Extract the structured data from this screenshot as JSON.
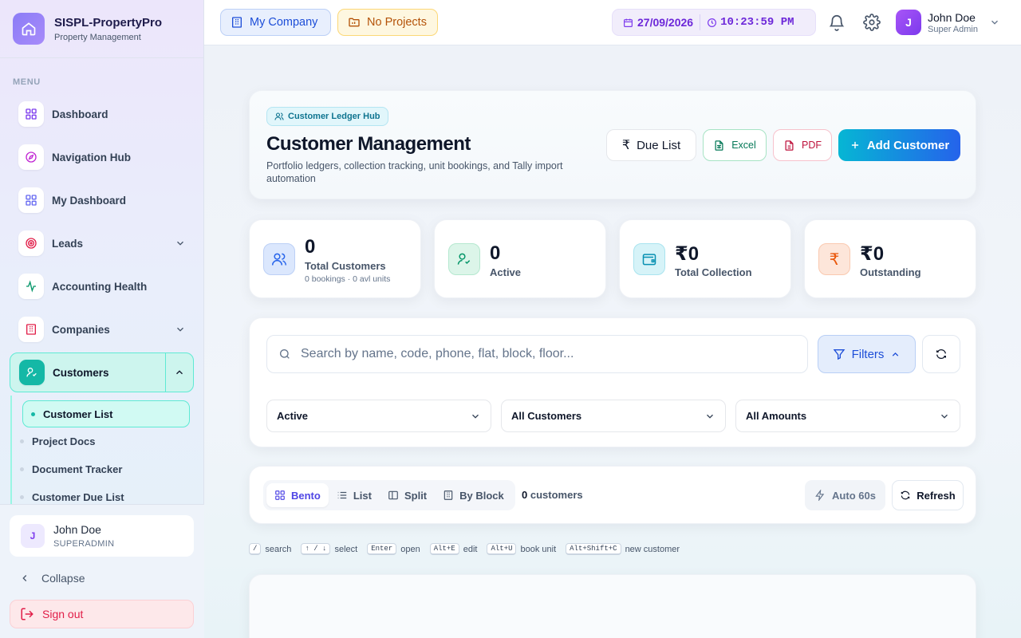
{
  "brand": {
    "name": "SISPL-PropertyPro",
    "subtitle": "Property Management"
  },
  "sidebar": {
    "menu_label": "MENU",
    "items": [
      {
        "label": "Dashboard",
        "icon": "grid-icon"
      },
      {
        "label": "Navigation Hub",
        "icon": "compass-icon"
      },
      {
        "label": "My Dashboard",
        "icon": "grid-icon"
      },
      {
        "label": "Leads",
        "icon": "target-icon",
        "expandable": true
      },
      {
        "label": "Accounting Health",
        "icon": "activity-icon"
      },
      {
        "label": "Companies",
        "icon": "building-icon",
        "expandable": true
      },
      {
        "label": "Customers",
        "icon": "user-check-icon",
        "expandable": true,
        "active": true
      }
    ],
    "subitems": [
      {
        "label": "Customer List",
        "active": true
      },
      {
        "label": "Project Docs"
      },
      {
        "label": "Document Tracker"
      },
      {
        "label": "Customer Due List"
      }
    ],
    "user": {
      "initial": "J",
      "name": "John Doe",
      "role": "SUPERADMIN"
    },
    "collapse_label": "Collapse",
    "signout_label": "Sign out"
  },
  "header": {
    "company_label": "My Company",
    "projects_label": "No Projects",
    "date": "27/09/2026",
    "time": "10:23:59 PM",
    "user": {
      "initial": "J",
      "name": "John Doe",
      "role": "Super Admin"
    }
  },
  "hero": {
    "chip": "Customer Ledger Hub",
    "title": "Customer Management",
    "subtitle": "Portfolio ledgers, collection tracking, unit bookings, and Tally import automation",
    "buttons": {
      "due": "Due List",
      "excel": "Excel",
      "pdf": "PDF",
      "add": "Add Customer"
    }
  },
  "stats": [
    {
      "value": "0",
      "label": "Total Customers",
      "sub": "0 bookings · 0 avl units"
    },
    {
      "value": "0",
      "label": "Active"
    },
    {
      "value": "₹0",
      "label": "Total Collection"
    },
    {
      "value": "₹0",
      "label": "Outstanding"
    }
  ],
  "filters": {
    "search_placeholder": "Search by name, code, phone, flat, block, floor...",
    "filters_label": "Filters",
    "selects": [
      "Active",
      "All Customers",
      "All Amounts"
    ]
  },
  "toolbar": {
    "views": [
      "Bento",
      "List",
      "Split",
      "By Block"
    ],
    "active_view": "Bento",
    "count": "0",
    "count_suffix": "customers",
    "auto_label": "Auto 60s",
    "refresh_label": "Refresh"
  },
  "shortcuts": [
    {
      "key": "/",
      "label": "search"
    },
    {
      "key": "↑ / ↓",
      "label": "select"
    },
    {
      "key": "Enter",
      "label": "open"
    },
    {
      "key": "Alt+E",
      "label": "edit"
    },
    {
      "key": "Alt+U",
      "label": "book unit"
    },
    {
      "key": "Alt+Shift+C",
      "label": "new customer"
    }
  ],
  "colors": {
    "accent": "#14b8a6",
    "primary": "#2563eb",
    "brand": "#8b7cf6"
  }
}
